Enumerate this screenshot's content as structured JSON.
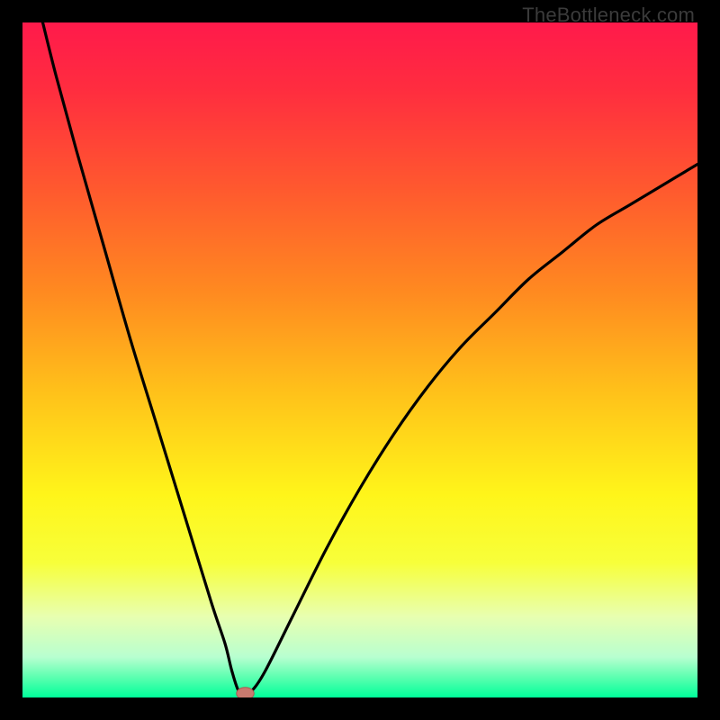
{
  "watermark": "TheBottleneck.com",
  "colors": {
    "black": "#000000",
    "gradient_stops": [
      {
        "offset": 0.0,
        "color": "#ff1a4b"
      },
      {
        "offset": 0.1,
        "color": "#ff2d3f"
      },
      {
        "offset": 0.25,
        "color": "#ff5a2e"
      },
      {
        "offset": 0.4,
        "color": "#ff8a20"
      },
      {
        "offset": 0.55,
        "color": "#ffc21a"
      },
      {
        "offset": 0.7,
        "color": "#fff51a"
      },
      {
        "offset": 0.8,
        "color": "#f7ff3a"
      },
      {
        "offset": 0.88,
        "color": "#e8ffb0"
      },
      {
        "offset": 0.94,
        "color": "#b8ffd0"
      },
      {
        "offset": 0.97,
        "color": "#5cffb0"
      },
      {
        "offset": 1.0,
        "color": "#00ff9a"
      }
    ],
    "curve": "#000000",
    "marker_fill": "#c97a6f",
    "marker_stroke": "#a85a52"
  },
  "chart_data": {
    "type": "line",
    "title": "",
    "xlabel": "",
    "ylabel": "",
    "xlim": [
      0,
      100
    ],
    "ylim": [
      0,
      100
    ],
    "grid": false,
    "legend": false,
    "series": [
      {
        "name": "bottleneck-curve",
        "x": [
          3,
          5,
          8,
          12,
          16,
          20,
          24,
          28,
          30,
          31,
          32,
          33,
          34,
          36,
          40,
          45,
          50,
          55,
          60,
          65,
          70,
          75,
          80,
          85,
          90,
          95,
          100
        ],
        "y": [
          100,
          92,
          81,
          67,
          53,
          40,
          27,
          14,
          8,
          4,
          1,
          0.5,
          1,
          4,
          12,
          22,
          31,
          39,
          46,
          52,
          57,
          62,
          66,
          70,
          73,
          76,
          79
        ]
      }
    ],
    "marker": {
      "x": 33,
      "y": 0.6,
      "rx": 1.3,
      "ry": 0.9
    }
  }
}
